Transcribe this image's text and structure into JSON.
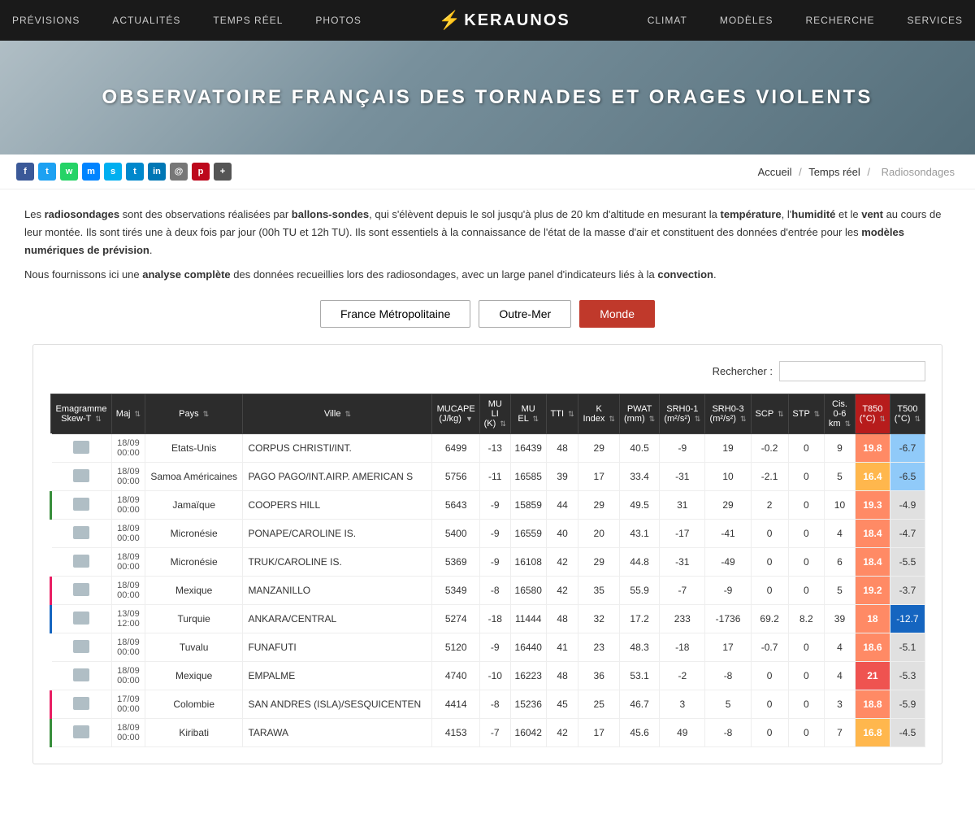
{
  "nav": {
    "left_items": [
      "PRÉVISIONS",
      "ACTUALITÉS",
      "TEMPS RÉEL",
      "PHOTOS"
    ],
    "right_items": [
      "CLIMAT",
      "MODÈLES",
      "RECHERCHE",
      "SERVICES"
    ],
    "logo": "KERAUNOS"
  },
  "hero": {
    "title": "OBSERVATOIRE FRANÇAIS DES TORNADES ET ORAGES VIOLENTS"
  },
  "social": {
    "icons": [
      {
        "name": "facebook",
        "color": "#3b5998",
        "label": "f"
      },
      {
        "name": "twitter",
        "color": "#1da1f2",
        "label": "t"
      },
      {
        "name": "whatsapp",
        "color": "#25d366",
        "label": "w"
      },
      {
        "name": "messenger",
        "color": "#0084ff",
        "label": "m"
      },
      {
        "name": "skype",
        "color": "#00aff0",
        "label": "s"
      },
      {
        "name": "telegram",
        "color": "#0088cc",
        "label": "t"
      },
      {
        "name": "linkedin",
        "color": "#0077b5",
        "label": "in"
      },
      {
        "name": "email",
        "color": "#777",
        "label": "@"
      },
      {
        "name": "pinterest",
        "color": "#bd081c",
        "label": "p"
      },
      {
        "name": "more",
        "color": "#555",
        "label": "+"
      }
    ]
  },
  "breadcrumb": {
    "home": "Accueil",
    "section": "Temps réel",
    "current": "Radiosondages"
  },
  "description": {
    "p1_start": "Les ",
    "p1_bold1": "radiosondages",
    "p1_mid1": " sont des observations réalisées par ",
    "p1_bold2": "ballons-sondes",
    "p1_mid2": ", qui s'élèvent depuis le sol jusqu'à plus de 20 km d'altitude en mesurant la ",
    "p1_bold3": "température",
    "p1_mid3": ", l'",
    "p1_bold4": "humidité",
    "p1_mid4": " et le ",
    "p1_bold5": "vent",
    "p1_end": " au cours de leur montée. Ils sont tirés une à deux fois par jour (00h TU et 12h TU). Ils sont essentiels à la connaissance de l'état de la masse d'air et constituent des données d'entrée pour les ",
    "p1_bold6": "modèles numériques de prévision",
    "p1_period": ".",
    "p2_start": "Nous fournissons ici une ",
    "p2_bold": "analyse complète",
    "p2_end": " des données recueillies lors des radiosondages, avec un large panel d'indicateurs liés à la ",
    "p2_bold2": "convection",
    "p2_period": "."
  },
  "buttons": {
    "france": "France Métropolitaine",
    "outremer": "Outre-Mer",
    "monde": "Monde"
  },
  "search": {
    "label": "Rechercher :",
    "placeholder": ""
  },
  "table": {
    "headers": [
      {
        "label": "Emagramme Skew-T",
        "sort": true
      },
      {
        "label": "Maj",
        "sort": true
      },
      {
        "label": "Pays",
        "sort": true
      },
      {
        "label": "Ville",
        "sort": true
      },
      {
        "label": "MUCAPE (J/kg)",
        "sort": true
      },
      {
        "label": "MU LI (K)",
        "sort": true
      },
      {
        "label": "MU EL",
        "sort": true
      },
      {
        "label": "TTI",
        "sort": true
      },
      {
        "label": "K Index",
        "sort": true
      },
      {
        "label": "PWAT (mm)",
        "sort": true
      },
      {
        "label": "SRH0-1 (m²/s²)",
        "sort": true
      },
      {
        "label": "SRH0-3 (m²/s²)",
        "sort": true
      },
      {
        "label": "SCP",
        "sort": true
      },
      {
        "label": "STP",
        "sort": true
      },
      {
        "label": "Cis. 0-6 km",
        "sort": true
      },
      {
        "label": "T850 (°C)",
        "sort": true
      },
      {
        "label": "T500 (°C)",
        "sort": true
      }
    ],
    "rows": [
      {
        "date": "18/09\n00:00",
        "pays": "Etats-Unis",
        "ville": "CORPUS CHRISTI/INT.",
        "mucape": 6499,
        "muli": -13,
        "muel": 16439,
        "tti": 48,
        "kindex": 29,
        "pwat": 40.5,
        "srh01": -9,
        "srh03": 19,
        "scp": -0.2,
        "stp": 0,
        "cis": 9,
        "t850": 19.8,
        "t500": -6.7,
        "t850color": "warm",
        "t500color": "light",
        "leftborder": "none"
      },
      {
        "date": "18/09\n00:00",
        "pays": "Samoa Américaines",
        "ville": "PAGO PAGO/INT.AIRP. AMERICAN S",
        "mucape": 5756,
        "muli": -11,
        "muel": 16585,
        "tti": 39,
        "kindex": 17,
        "pwat": 33.4,
        "srh01": -31,
        "srh03": 10,
        "scp": -2.1,
        "stp": 0,
        "cis": 5,
        "t850": 16.4,
        "t500": -6.5,
        "t850color": "warm",
        "t500color": "light",
        "leftborder": "none"
      },
      {
        "date": "18/09\n00:00",
        "pays": "Jamaïque",
        "ville": "COOPERS HILL",
        "mucape": 5643,
        "muli": -9,
        "muel": 15859,
        "tti": 44,
        "kindex": 29,
        "pwat": 49.5,
        "srh01": 31,
        "srh03": 29,
        "scp": 2,
        "stp": 0,
        "cis": 10,
        "t850": 19.3,
        "t500": -4.9,
        "t850color": "warm",
        "t500color": "light",
        "leftborder": "green"
      },
      {
        "date": "18/09\n00:00",
        "pays": "Micronésie",
        "ville": "PONAPE/CAROLINE IS.",
        "mucape": 5400,
        "muli": -9,
        "muel": 16559,
        "tti": 40,
        "kindex": 20,
        "pwat": 43.1,
        "srh01": -17,
        "srh03": -41,
        "scp": 0,
        "stp": 0,
        "cis": 4,
        "t850": 18.4,
        "t500": -4.7,
        "t850color": "warm",
        "t500color": "light",
        "leftborder": "none"
      },
      {
        "date": "18/09\n00:00",
        "pays": "Micronésie",
        "ville": "TRUK/CAROLINE IS.",
        "mucape": 5369,
        "muli": -9,
        "muel": 16108,
        "tti": 42,
        "kindex": 29,
        "pwat": 44.8,
        "srh01": -31,
        "srh03": -49,
        "scp": 0,
        "stp": 0,
        "cis": 6,
        "t850": 18.4,
        "t500": -5.5,
        "t850color": "warm",
        "t500color": "light",
        "leftborder": "none"
      },
      {
        "date": "18/09\n00:00",
        "pays": "Mexique",
        "ville": "MANZANILLO",
        "mucape": 5349,
        "muli": -8,
        "muel": 16580,
        "tti": 42,
        "kindex": 35,
        "pwat": 55.9,
        "srh01": -7,
        "srh03": -9,
        "scp": 0,
        "stp": 0,
        "cis": 5,
        "t850": 19.2,
        "t500": -3.7,
        "t850color": "warm",
        "t500color": "light",
        "leftborder": "pink"
      },
      {
        "date": "13/09\n12:00",
        "pays": "Turquie",
        "ville": "ANKARA/CENTRAL",
        "mucape": 5274,
        "muli": -18,
        "muel": 11444,
        "tti": 48,
        "kindex": 32,
        "pwat": 17.2,
        "srh01": 233,
        "srh03": -1736,
        "scp": 69.2,
        "stp": 8.2,
        "cis": 39,
        "t850": 18,
        "t500": -12.7,
        "t850color": "warm",
        "t500color": "blue",
        "leftborder": "blue"
      },
      {
        "date": "18/09\n00:00",
        "pays": "Tuvalu",
        "ville": "FUNAFUTI",
        "mucape": 5120,
        "muli": -9,
        "muel": 16440,
        "tti": 41,
        "kindex": 23,
        "pwat": 48.3,
        "srh01": -18,
        "srh03": 17,
        "scp": -0.7,
        "stp": 0,
        "cis": 4,
        "t850": 18.6,
        "t500": -5.1,
        "t850color": "warm",
        "t500color": "light",
        "leftborder": "none"
      },
      {
        "date": "18/09\n00:00",
        "pays": "Mexique",
        "ville": "EMPALME",
        "mucape": 4740,
        "muli": -10,
        "muel": 16223,
        "tti": 48,
        "kindex": 36,
        "pwat": 53.1,
        "srh01": -2,
        "srh03": -8,
        "scp": 0,
        "stp": 0,
        "cis": 4,
        "t850": 21,
        "t500": -5.3,
        "t850color": "hot",
        "t500color": "light",
        "leftborder": "none"
      },
      {
        "date": "17/09\n00:00",
        "pays": "Colombie",
        "ville": "SAN ANDRES (ISLA)/SESQUICENTEN",
        "mucape": 4414,
        "muli": -8,
        "muel": 15236,
        "tti": 45,
        "kindex": 25,
        "pwat": 46.7,
        "srh01": 3,
        "srh03": 5,
        "scp": 0,
        "stp": 0,
        "cis": 3,
        "t850": 18.8,
        "t500": -5.9,
        "t850color": "warm",
        "t500color": "light",
        "leftborder": "pink"
      },
      {
        "date": "18/09\n00:00",
        "pays": "Kiribati",
        "ville": "TARAWA",
        "mucape": 4153,
        "muli": -7,
        "muel": 16042,
        "tti": 42,
        "kindex": 17,
        "pwat": 45.6,
        "srh01": 49,
        "srh03": -8,
        "scp": 0,
        "stp": 0,
        "cis": 7,
        "t850": 16.8,
        "t500": -4.5,
        "t850color": "warm",
        "t500color": "light",
        "leftborder": "green"
      }
    ]
  }
}
